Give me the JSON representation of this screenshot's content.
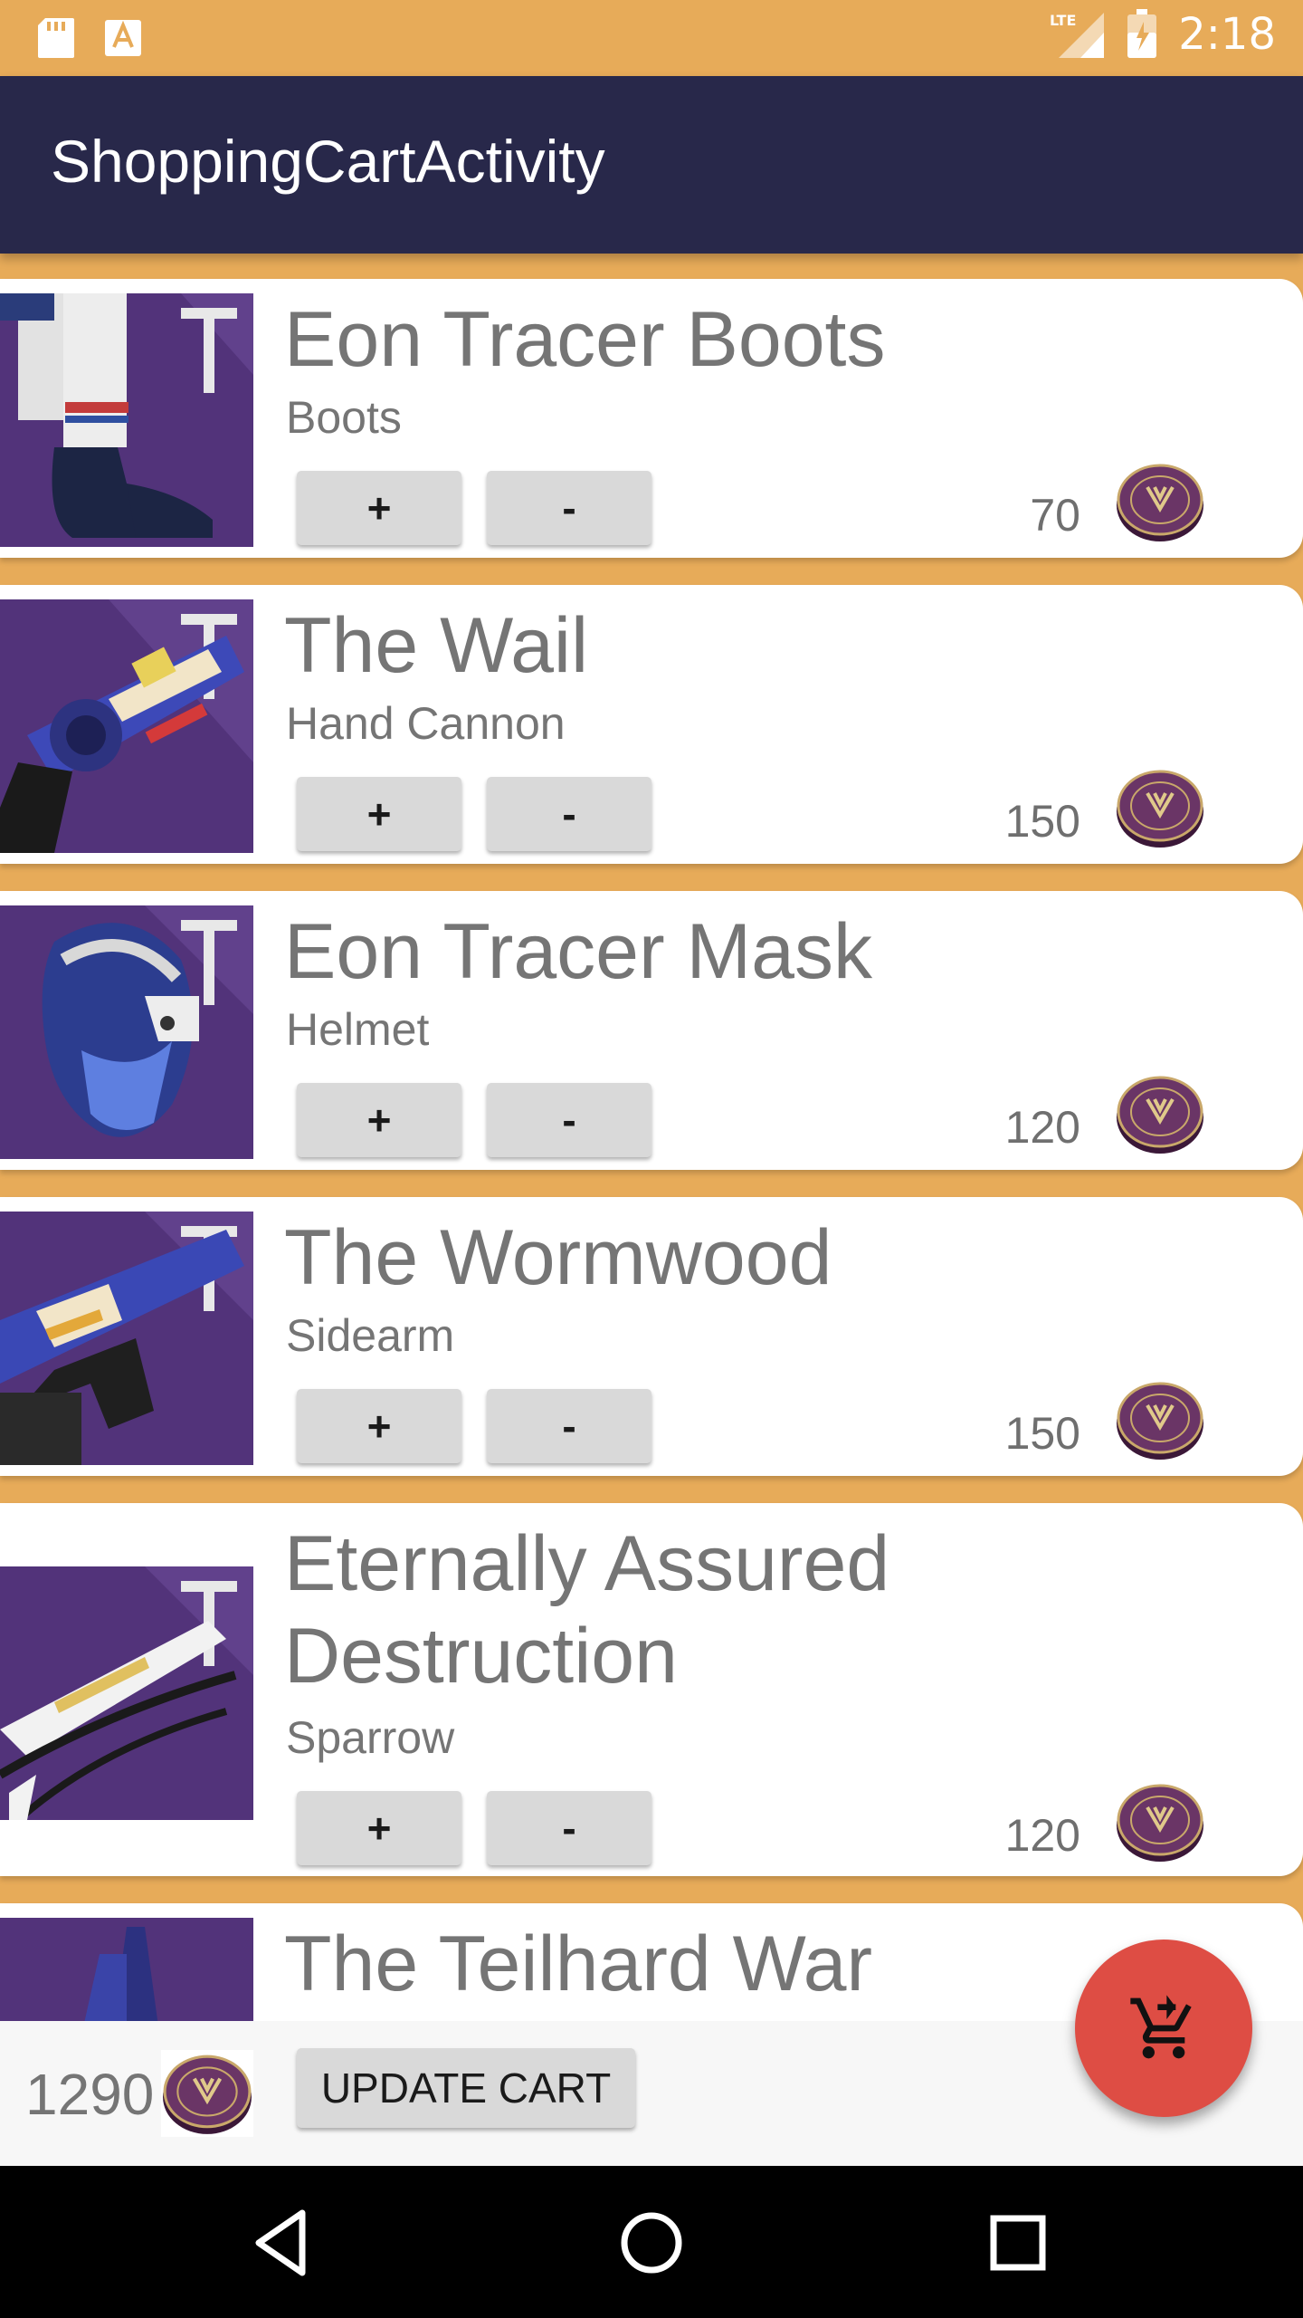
{
  "status_bar": {
    "time": "2:18",
    "network": "LTE",
    "icons": [
      "sd-card-icon",
      "app-notification-icon",
      "signal-icon",
      "battery-icon"
    ]
  },
  "app_bar": {
    "title": "ShoppingCartActivity"
  },
  "cart": {
    "items": [
      {
        "name": "Eon Tracer Boots",
        "type": "Boots",
        "price": "70",
        "plus_label": "+",
        "minus_label": "-"
      },
      {
        "name": "The Wail",
        "type": "Hand Cannon",
        "price": "150",
        "plus_label": "+",
        "minus_label": "-"
      },
      {
        "name": "Eon Tracer Mask",
        "type": "Helmet",
        "price": "120",
        "plus_label": "+",
        "minus_label": "-"
      },
      {
        "name": "The Wormwood",
        "type": "Sidearm",
        "price": "150",
        "plus_label": "+",
        "minus_label": "-"
      },
      {
        "name": "Eternally Assured Destruction",
        "type": "Sparrow",
        "price": "120",
        "plus_label": "+",
        "minus_label": "-"
      },
      {
        "name": "The Teilhard War",
        "type": "",
        "price": "",
        "plus_label": "",
        "minus_label": ""
      }
    ]
  },
  "footer": {
    "total": "1290",
    "update_label": "UPDATE CART"
  },
  "fab": {
    "icon": "cart-icon"
  },
  "nav": {
    "icons": [
      "back-icon",
      "home-icon",
      "recents-icon"
    ]
  },
  "colors": {
    "background": "#E7AB59",
    "app_bar": "#28284A",
    "fab": "#DE4D44",
    "thumb": "#52337A",
    "coin": "#5B2A5C"
  }
}
